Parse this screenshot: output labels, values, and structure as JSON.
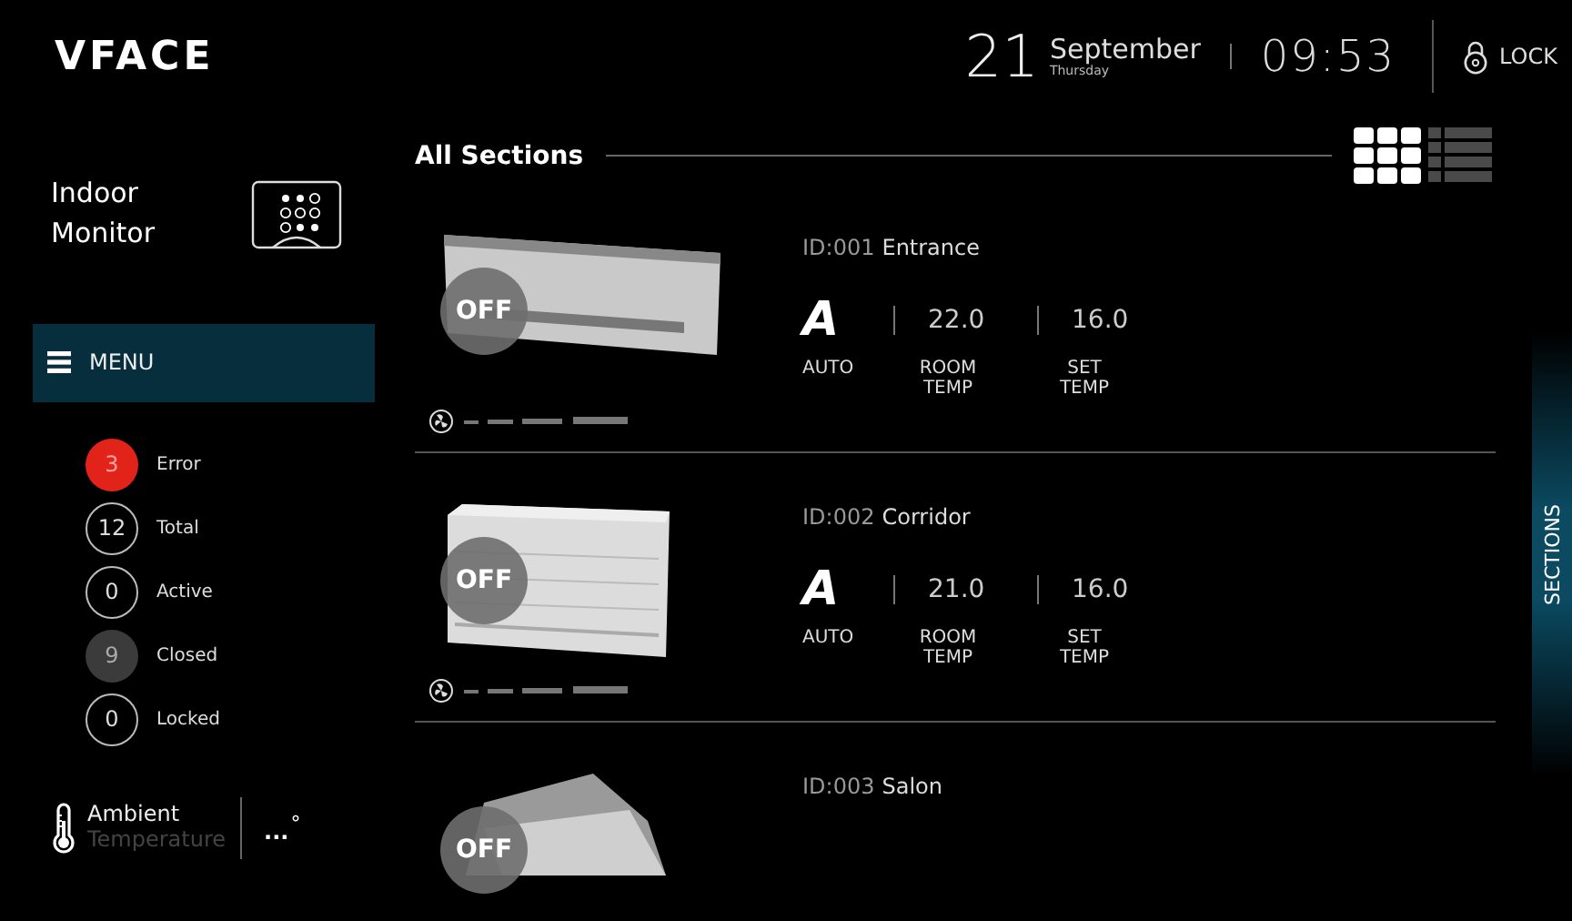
{
  "header": {
    "logo": "VFACE",
    "day": "21",
    "month": "September",
    "weekday": "Thursday",
    "time": "09:53",
    "lock": "LOCK"
  },
  "sidebar": {
    "title": "Indoor Monitor",
    "menu": "MENU",
    "stats": [
      {
        "kind": "error",
        "count": "3",
        "label": "Error"
      },
      {
        "kind": "outline",
        "count": "12",
        "label": "Total"
      },
      {
        "kind": "outline",
        "count": "0",
        "label": "Active"
      },
      {
        "kind": "muted",
        "count": "9",
        "label": "Closed"
      },
      {
        "kind": "outline",
        "count": "0",
        "label": "Locked"
      }
    ],
    "ambient": {
      "label": "Ambient",
      "sublabel": "Temperature",
      "value": "...",
      "unit": "°"
    }
  },
  "main": {
    "title": "All Sections",
    "views": [
      {
        "kind": "grid",
        "selected": true
      },
      {
        "kind": "list",
        "selected": false
      }
    ],
    "units": [
      {
        "kind": "wall",
        "power": "OFF",
        "id": "ID:001",
        "name": "Entrance",
        "mode_icon": "A",
        "room_temp": "22.0",
        "set_temp": "16.0",
        "mode_label": "AUTO",
        "room_label": "ROOM TEMP",
        "set_label": "SET TEMP"
      },
      {
        "kind": "cabinet",
        "power": "OFF",
        "id": "ID:002",
        "name": "Corridor",
        "mode_icon": "A",
        "room_temp": "21.0",
        "set_temp": "16.0",
        "mode_label": "AUTO",
        "room_label": "ROOM TEMP",
        "set_label": "SET TEMP"
      },
      {
        "kind": "ceiling",
        "power": "OFF",
        "id": "ID:003",
        "name": "Salon"
      }
    ]
  },
  "side_tab": {
    "label": "SECTIONS"
  }
}
